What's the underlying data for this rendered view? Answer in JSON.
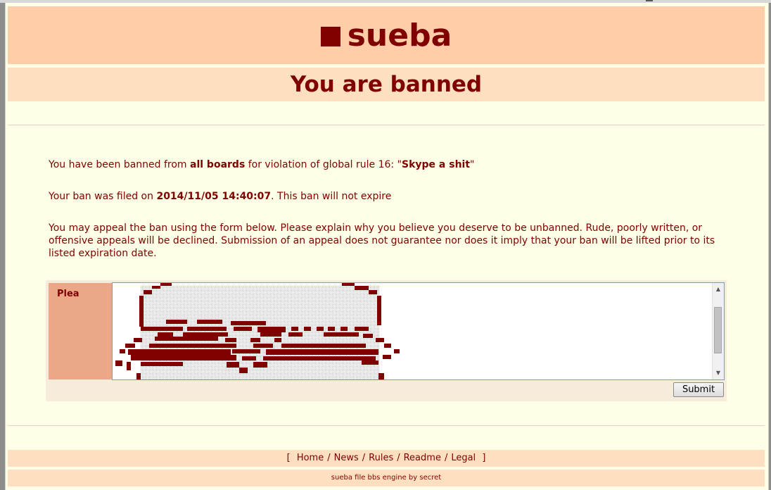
{
  "site": {
    "title": "sueba"
  },
  "page": {
    "heading": "You are banned"
  },
  "ban": {
    "line1_pre": "You have been banned from ",
    "scope": "all boards",
    "line1_mid": " for violation of global rule 16: \"",
    "reason": "Skype a shit",
    "line1_end": "\"",
    "line2_pre": "Your ban was filed on ",
    "filed_on": "2014/11/05 14:40:07",
    "line2_end": ". This ban will not expire",
    "appeal_text": "You may appeal the ban using the form below. Please explain why you believe you deserve to be unbanned. Rude, poorly written, or offensive appeals will be declined. Submission of an appeal does not guarantee nor does it imply that your ban will be lifted prior to its listed expiration date."
  },
  "form": {
    "plea_label": "Plea",
    "submit_label": "Submit"
  },
  "footer": {
    "open_bracket": "[",
    "close_bracket": "]",
    "separator": "/",
    "links": [
      "Home",
      "News",
      "Rules",
      "Readme",
      "Legal"
    ],
    "credit": "sueba file bbs engine by secret"
  },
  "colors": {
    "primary": "#800000",
    "header_bg": "#ffcda7",
    "banner_bg": "#fedfc1",
    "page_bg": "#fffee6",
    "label_bg": "#eaa888"
  }
}
